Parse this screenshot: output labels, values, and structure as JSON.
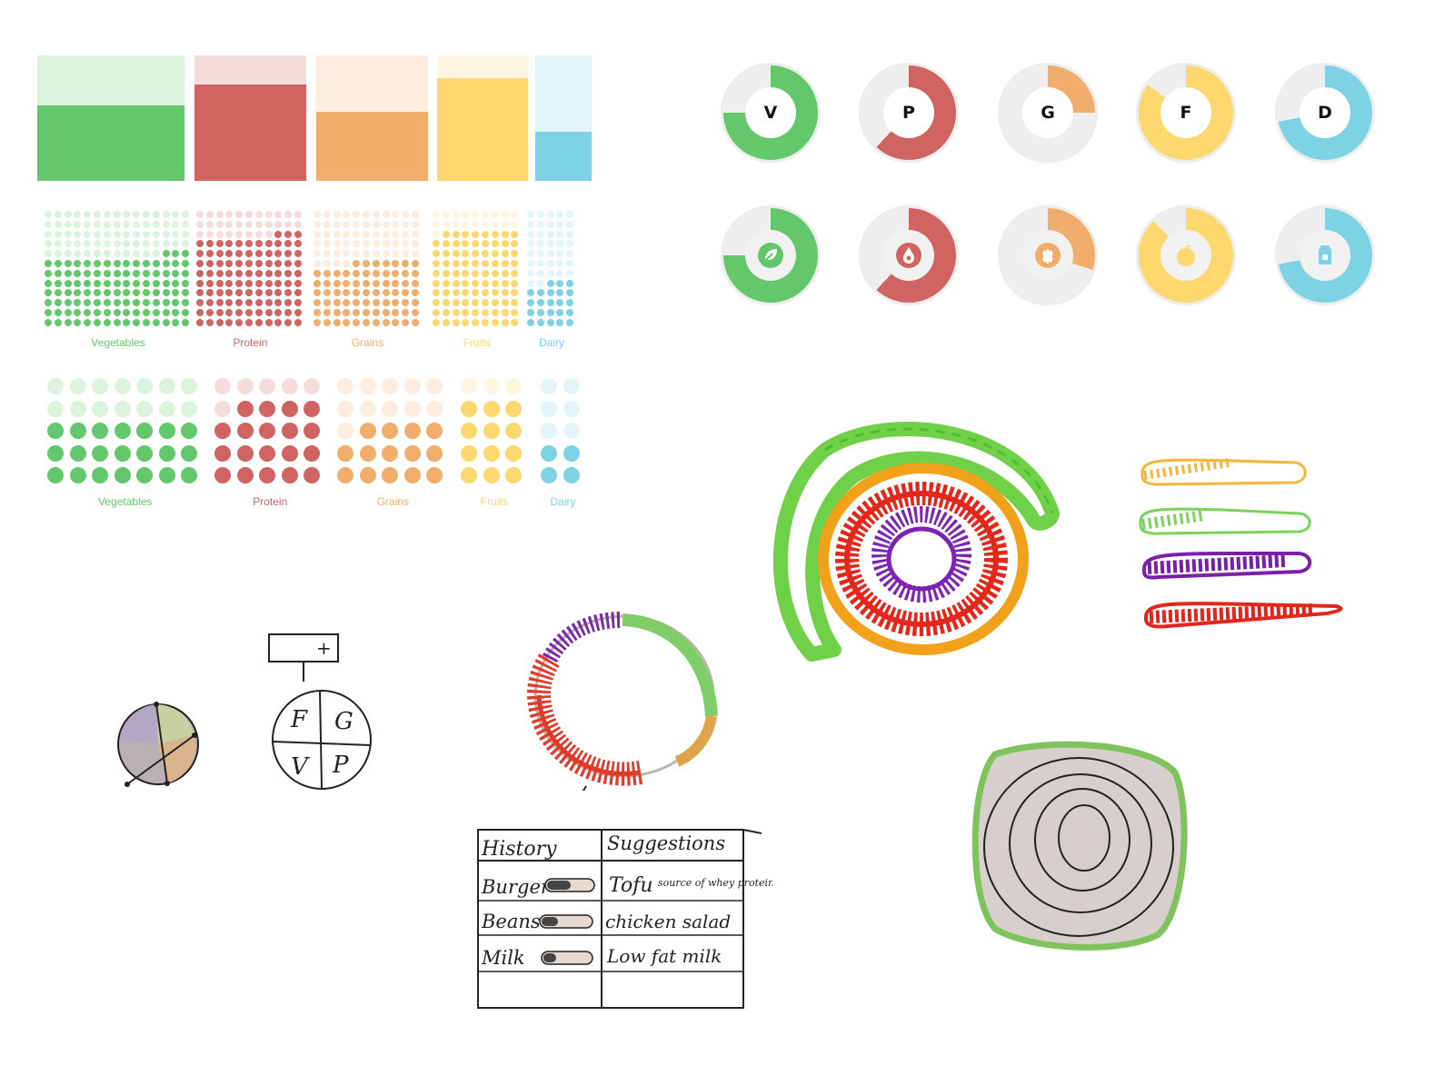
{
  "colors": {
    "vegetables": "#62c86b",
    "protein": "#d06462",
    "grains": "#f0ad6c",
    "fruits": "#fcd86e",
    "dairy": "#7dd3e3"
  },
  "categories": [
    {
      "key": "vegetables",
      "label": "Vegetables",
      "letter": "V",
      "icon": "leaf-icon",
      "fill_fraction": 0.6
    },
    {
      "key": "protein",
      "label": "Protein",
      "letter": "P",
      "icon": "blood-drop-icon",
      "fill_fraction": 0.77
    },
    {
      "key": "grains",
      "label": "Grains",
      "letter": "G",
      "icon": "wheat-icon",
      "fill_fraction": 0.55
    },
    {
      "key": "fruits",
      "label": "Fruits",
      "letter": "F",
      "icon": "orange-fruit-icon",
      "fill_fraction": 0.82
    },
    {
      "key": "dairy",
      "label": "Dairy",
      "letter": "D",
      "icon": "milk-carton-icon",
      "fill_fraction": 0.39
    }
  ],
  "ring_levels_row1": [
    0.75,
    0.62,
    0.25,
    0.85,
    0.72
  ],
  "ring_levels_row2": [
    0.75,
    0.62,
    0.3,
    0.88,
    0.72
  ],
  "sketch": {
    "quad_labels": [
      "F",
      "G",
      "V",
      "P"
    ],
    "plus_label": "+",
    "table_headers": [
      "History",
      "Suggestions"
    ],
    "history": [
      "Burger",
      "Beans",
      "Milk"
    ],
    "suggestions": [
      "Tofu",
      "chicken salad",
      "Low fat milk"
    ],
    "suggestion_note": "source of whey protein"
  }
}
